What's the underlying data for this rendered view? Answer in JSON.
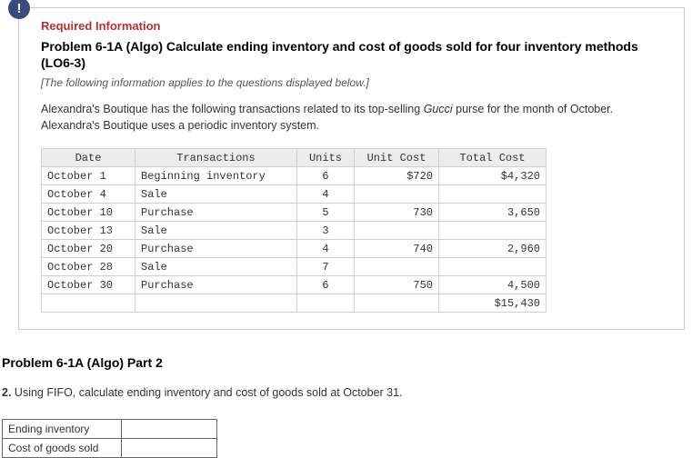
{
  "badge": "!",
  "req_header": "Required Information",
  "title": "Problem 6-1A (Algo) Calculate ending inventory and cost of goods sold for four inventory methods (LO6-3)",
  "sub": "[The following information applies to the questions displayed below.]",
  "para_pre": "Alexandra's Boutique has the following transactions related to its top-selling ",
  "para_italic": "Gucci",
  "para_post": " purse for the month of October. Alexandra's Boutique uses a periodic inventory system.",
  "headers": {
    "date": "Date",
    "trans": "Transactions",
    "units": "Units",
    "cost": "Unit Cost",
    "total": "Total Cost"
  },
  "rows": [
    {
      "date": "October 1",
      "trans": "Beginning inventory",
      "units": "6",
      "cost": "$720",
      "total": "$4,320"
    },
    {
      "date": "October 4",
      "trans": "Sale",
      "units": "4",
      "cost": "",
      "total": ""
    },
    {
      "date": "October 10",
      "trans": "Purchase",
      "units": "5",
      "cost": "730",
      "total": "3,650"
    },
    {
      "date": "October 13",
      "trans": "Sale",
      "units": "3",
      "cost": "",
      "total": ""
    },
    {
      "date": "October 20",
      "trans": "Purchase",
      "units": "4",
      "cost": "740",
      "total": "2,960"
    },
    {
      "date": "October 28",
      "trans": "Sale",
      "units": "7",
      "cost": "",
      "total": ""
    },
    {
      "date": "October 30",
      "trans": "Purchase",
      "units": "6",
      "cost": "750",
      "total": "4,500"
    }
  ],
  "grand_total": "$15,430",
  "part_title": "Problem 6-1A (Algo) Part 2",
  "question_num": "2.",
  "question_text": " Using FIFO, calculate ending inventory and cost of goods sold at October 31.",
  "answer_rows": {
    "ei": "Ending inventory",
    "cogs": "Cost of goods sold"
  },
  "chart_data": {
    "type": "table",
    "title": "October transactions – periodic inventory",
    "columns": [
      "Date",
      "Transactions",
      "Units",
      "Unit Cost",
      "Total Cost"
    ],
    "data": [
      [
        "October 1",
        "Beginning inventory",
        6,
        720,
        4320
      ],
      [
        "October 4",
        "Sale",
        4,
        null,
        null
      ],
      [
        "October 10",
        "Purchase",
        5,
        730,
        3650
      ],
      [
        "October 13",
        "Sale",
        3,
        null,
        null
      ],
      [
        "October 20",
        "Purchase",
        4,
        740,
        2960
      ],
      [
        "October 28",
        "Sale",
        7,
        null,
        null
      ],
      [
        "October 30",
        "Purchase",
        6,
        750,
        4500
      ]
    ],
    "total_cost": 15430
  }
}
